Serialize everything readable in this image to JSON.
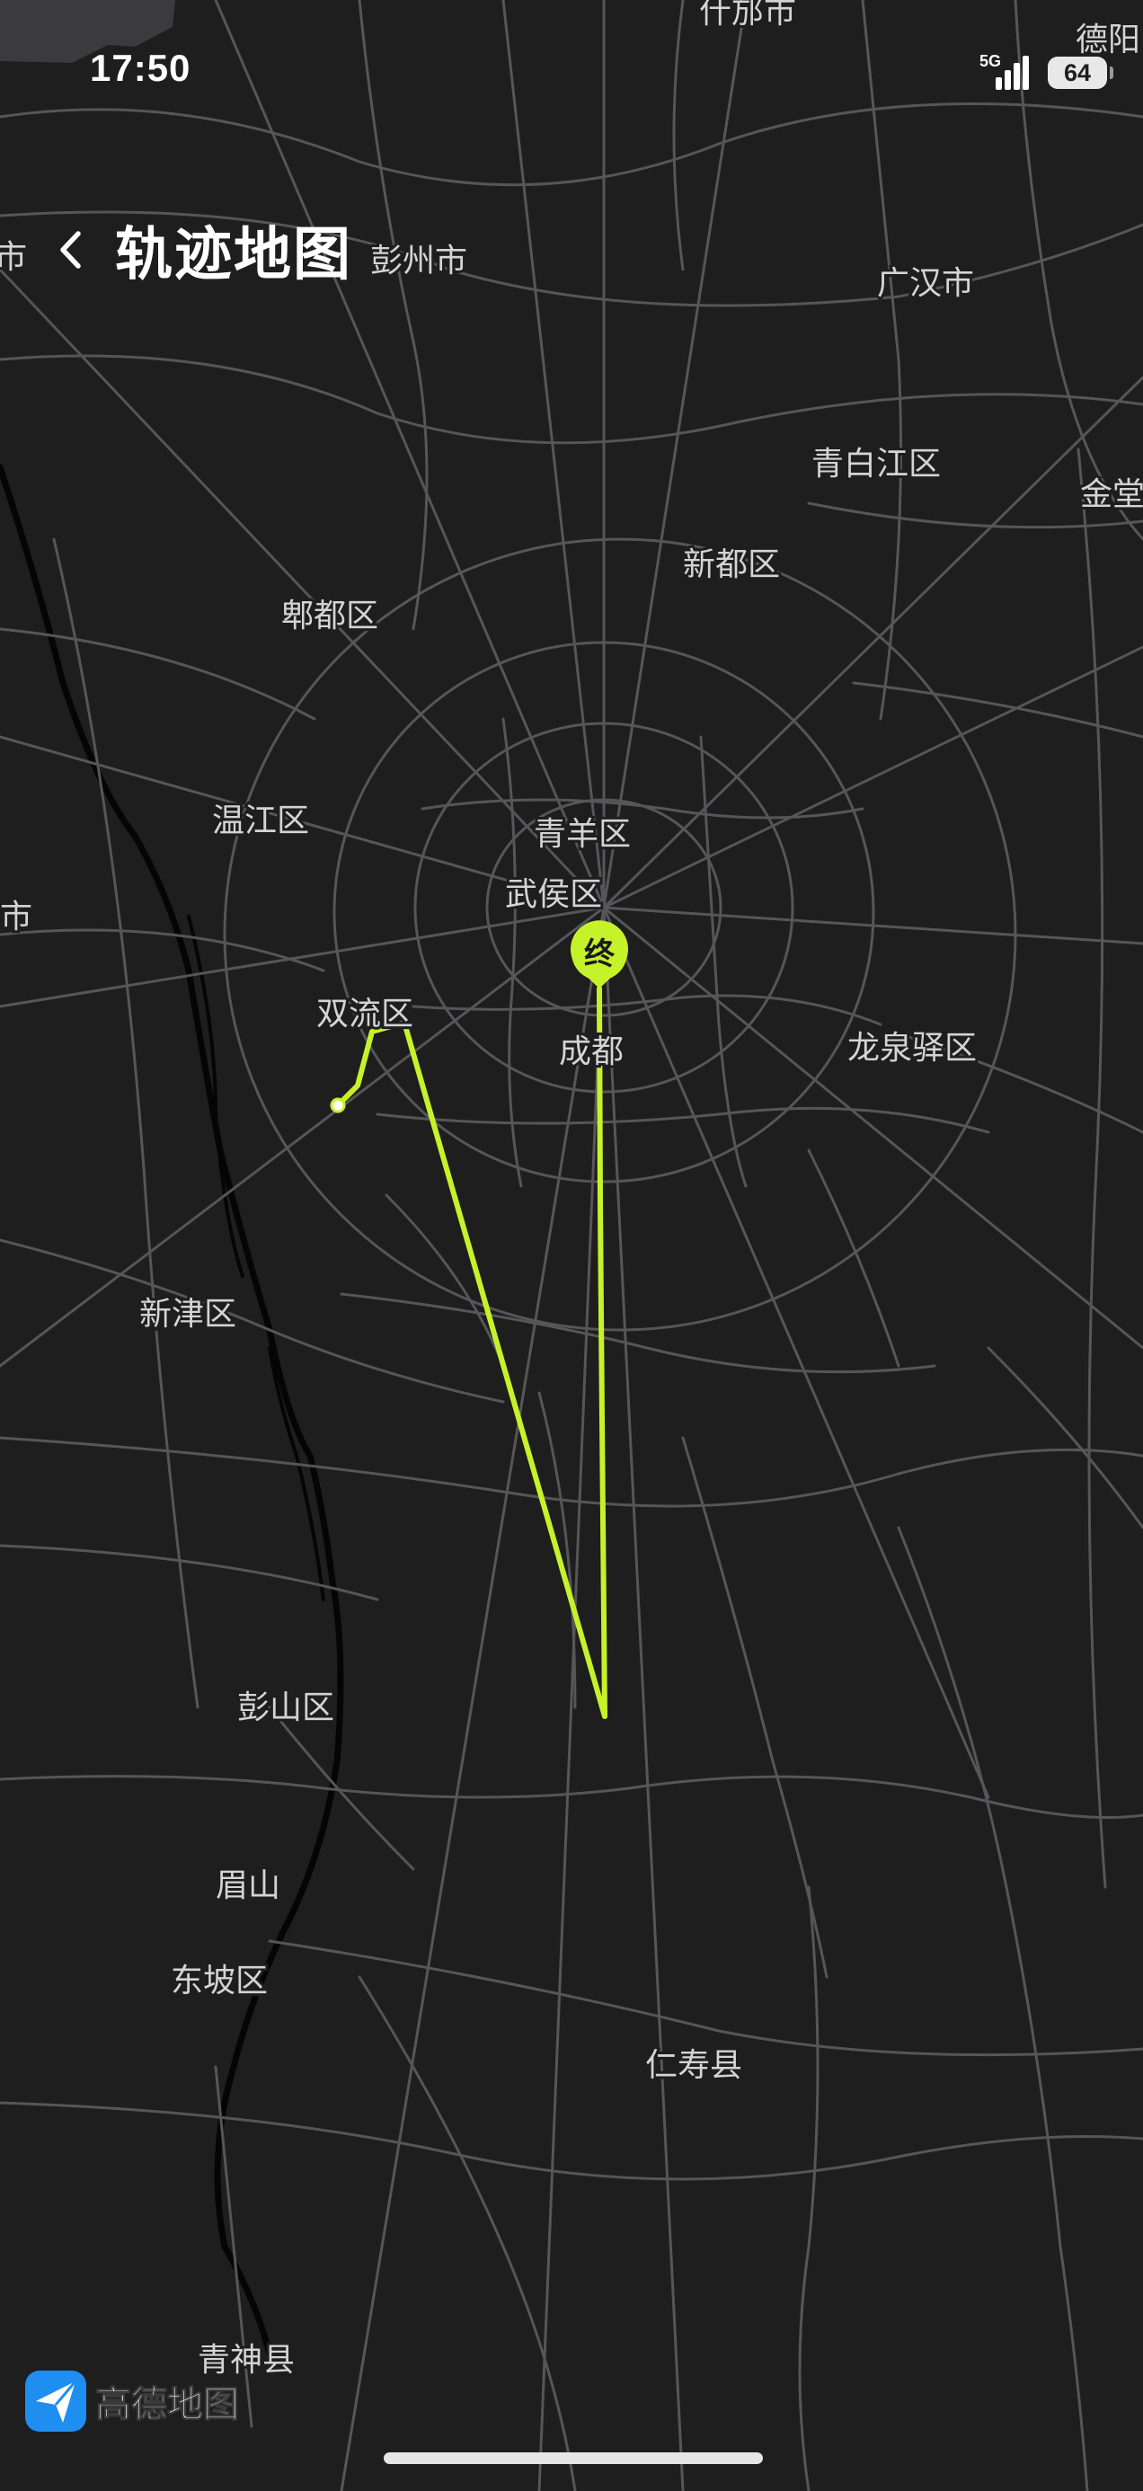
{
  "status_bar": {
    "time": "17:50",
    "network": "5G",
    "battery": "64"
  },
  "header": {
    "title": "轨迹地图",
    "back_icon": "chevron-left-icon"
  },
  "map": {
    "theme": "dark",
    "background_color": "#1e1e1f",
    "road_color": "#5a5a5c",
    "label_color": "#d4d4d4",
    "labels": [
      "什邡市",
      "德阳",
      "彭州市",
      "广汉市",
      "青白江区",
      "金堂",
      "新都区",
      "郫都区",
      "温江区",
      "青羊区",
      "武侯区",
      "市",
      "双流区",
      "成都",
      "龙泉驿区",
      "新津区",
      "彭山区",
      "眉山",
      "东坡区",
      "仁寿县",
      "青神县"
    ],
    "edge_fragment": "市"
  },
  "track": {
    "color": "#c6f22b",
    "end_marker_label": "终"
  },
  "map_provider": {
    "name": "高德地图",
    "icon": "navigation-arrow-icon"
  }
}
